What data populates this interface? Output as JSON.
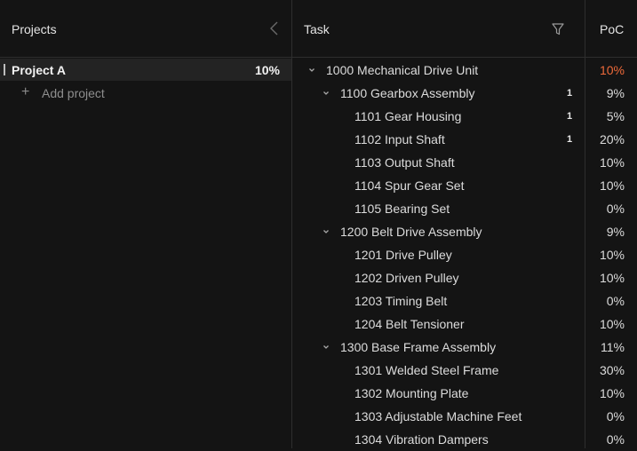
{
  "projects_panel": {
    "title": "Projects",
    "items": [
      {
        "name": "Project A",
        "percent": "10%"
      }
    ],
    "add_label": "Add project"
  },
  "task_header": {
    "title": "Task"
  },
  "poc_header": {
    "title": "PoC"
  },
  "colors": {
    "background": "#141414",
    "alert": "#ef6a3a"
  },
  "tasks": [
    {
      "name": "1000 Mechanical Drive Unit",
      "level": 0,
      "expandable": true,
      "badge": "",
      "poc": "10%",
      "alert": true
    },
    {
      "name": "1100 Gearbox Assembly",
      "level": 1,
      "expandable": true,
      "badge": "1",
      "poc": "9%"
    },
    {
      "name": "1101 Gear Housing",
      "level": 2,
      "expandable": false,
      "badge": "1",
      "poc": "5%"
    },
    {
      "name": "1102 Input Shaft",
      "level": 2,
      "expandable": false,
      "badge": "1",
      "poc": "20%"
    },
    {
      "name": "1103 Output Shaft",
      "level": 2,
      "expandable": false,
      "badge": "",
      "poc": "10%"
    },
    {
      "name": "1104 Spur Gear Set",
      "level": 2,
      "expandable": false,
      "badge": "",
      "poc": "10%"
    },
    {
      "name": "1105 Bearing Set",
      "level": 2,
      "expandable": false,
      "badge": "",
      "poc": "0%"
    },
    {
      "name": "1200 Belt Drive Assembly",
      "level": 1,
      "expandable": true,
      "badge": "",
      "poc": "9%"
    },
    {
      "name": "1201 Drive Pulley",
      "level": 2,
      "expandable": false,
      "badge": "",
      "poc": "10%"
    },
    {
      "name": "1202 Driven Pulley",
      "level": 2,
      "expandable": false,
      "badge": "",
      "poc": "10%"
    },
    {
      "name": "1203 Timing Belt",
      "level": 2,
      "expandable": false,
      "badge": "",
      "poc": "0%"
    },
    {
      "name": "1204 Belt Tensioner",
      "level": 2,
      "expandable": false,
      "badge": "",
      "poc": "10%"
    },
    {
      "name": "1300 Base Frame Assembly",
      "level": 1,
      "expandable": true,
      "badge": "",
      "poc": "11%"
    },
    {
      "name": "1301 Welded Steel Frame",
      "level": 2,
      "expandable": false,
      "badge": "",
      "poc": "30%"
    },
    {
      "name": "1302 Mounting Plate",
      "level": 2,
      "expandable": false,
      "badge": "",
      "poc": "10%"
    },
    {
      "name": "1303 Adjustable Machine Feet",
      "level": 2,
      "expandable": false,
      "badge": "",
      "poc": "0%"
    },
    {
      "name": "1304 Vibration Dampers",
      "level": 2,
      "expandable": false,
      "badge": "",
      "poc": "0%"
    }
  ]
}
